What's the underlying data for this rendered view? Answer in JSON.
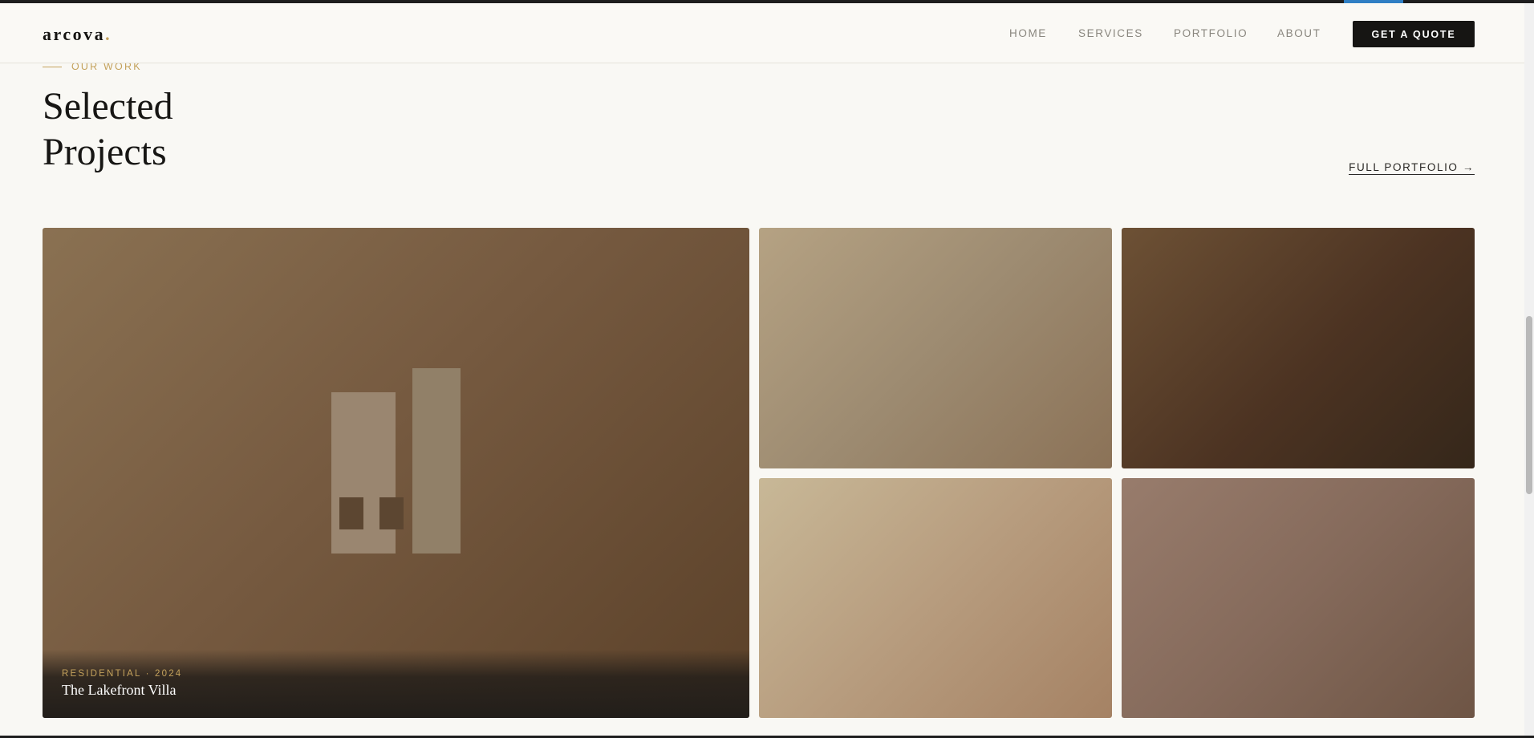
{
  "header": {
    "logo_text": "arcova",
    "logo_dot": ".",
    "nav": [
      {
        "label": "HOME"
      },
      {
        "label": "SERVICES"
      },
      {
        "label": "PORTFOLIO"
      },
      {
        "label": "ABOUT"
      }
    ],
    "cta_label": "GET A QUOTE"
  },
  "section": {
    "eyebrow": "OUR WORK",
    "title_line1": "Selected",
    "title_line2": "Projects",
    "portfolio_link": "FULL PORTFOLIO →"
  },
  "projects": {
    "featured": {
      "meta": "RESIDENTIAL · 2024",
      "name": "The Lakefront Villa"
    }
  },
  "colors": {
    "accent": "#c4a25c",
    "dark": "#161513",
    "background": "#f9f8f4"
  }
}
